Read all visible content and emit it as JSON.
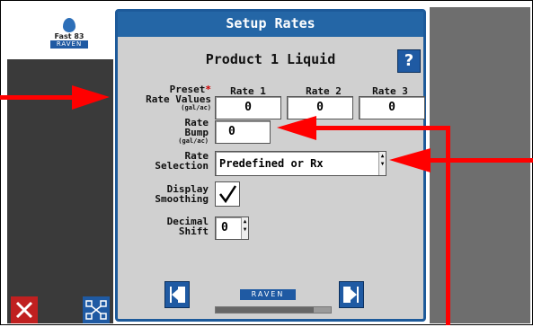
{
  "app": {
    "logo_line1": "Fast 83",
    "logo_line2": "RAVEN"
  },
  "dialog": {
    "title": "Setup Rates",
    "product": "Product 1 Liquid",
    "help_label": "?",
    "columns": [
      "Rate 1",
      "Rate 2",
      "Rate 3"
    ],
    "preset": {
      "label_line1": "Preset",
      "label_line2": "Rate Values",
      "unit": "(gal/ac)",
      "values": [
        "0",
        "0",
        "0"
      ]
    },
    "bump": {
      "label_line1": "Rate",
      "label_line2": "Bump",
      "unit": "(gal/ac)",
      "value": "0"
    },
    "selection": {
      "label_line1": "Rate",
      "label_line2": "Selection",
      "value": "Predefined or Rx"
    },
    "smoothing": {
      "label_line1": "Display",
      "label_line2": "Smoothing",
      "checked": true
    },
    "decimal": {
      "label_line1": "Decimal",
      "label_line2": "Shift",
      "value": "0"
    },
    "raven_badge": "RAVEN",
    "progress": 0.85
  },
  "colors": {
    "title_bar": "#2466a6",
    "accent_blue": "#1f5aa3",
    "arrow": "#ff0000",
    "cancel": "#c02020"
  }
}
